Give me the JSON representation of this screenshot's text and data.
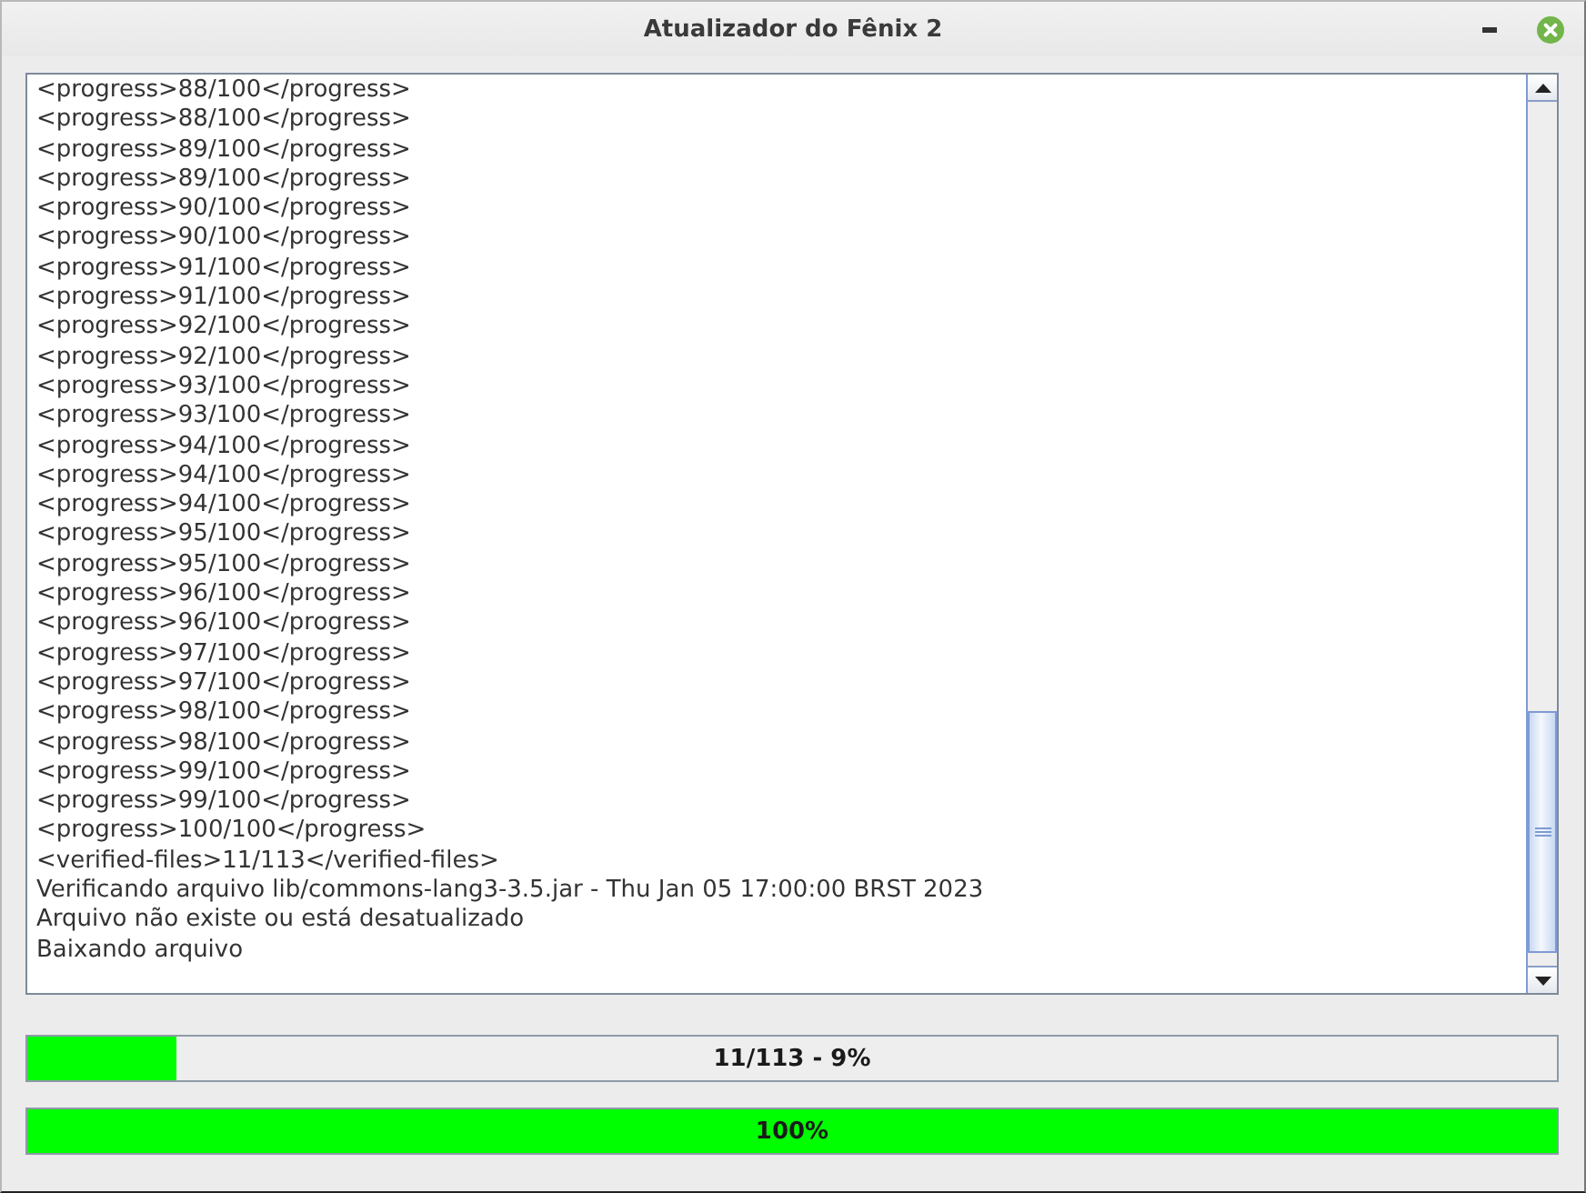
{
  "window": {
    "title": "Atualizador do Fênix 2"
  },
  "log": {
    "lines": [
      "<progress>88/100</progress>",
      "<progress>88/100</progress>",
      "<progress>89/100</progress>",
      "<progress>89/100</progress>",
      "<progress>90/100</progress>",
      "<progress>90/100</progress>",
      "<progress>91/100</progress>",
      "<progress>91/100</progress>",
      "<progress>92/100</progress>",
      "<progress>92/100</progress>",
      "<progress>93/100</progress>",
      "<progress>93/100</progress>",
      "<progress>94/100</progress>",
      "<progress>94/100</progress>",
      "<progress>94/100</progress>",
      "<progress>95/100</progress>",
      "<progress>95/100</progress>",
      "<progress>96/100</progress>",
      "<progress>96/100</progress>",
      "<progress>97/100</progress>",
      "<progress>97/100</progress>",
      "<progress>98/100</progress>",
      "<progress>98/100</progress>",
      "<progress>99/100</progress>",
      "<progress>99/100</progress>",
      "<progress>100/100</progress>",
      "<verified-files>11/113</verified-files>",
      "Verificando arquivo lib/commons-lang3-3.5.jar - Thu Jan 05 17:00:00 BRST 2023",
      "Arquivo não existe ou está desatualizado",
      "Baixando arquivo"
    ]
  },
  "progress_bars": [
    {
      "label": "11/113 - 9%",
      "level": 0.097
    },
    {
      "label": "100%",
      "level": 1
    }
  ]
}
